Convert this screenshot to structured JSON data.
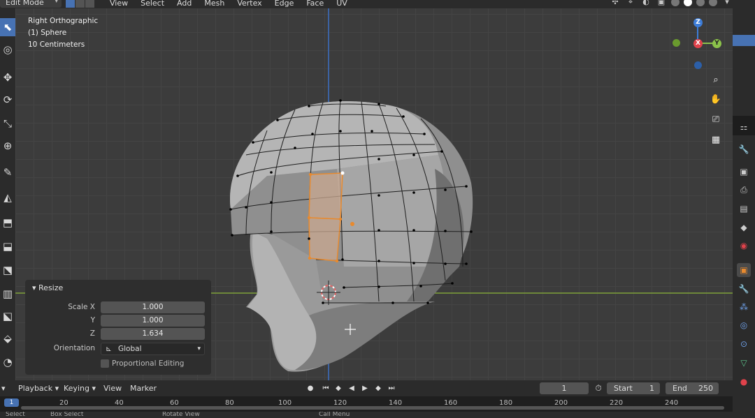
{
  "header": {
    "mode": "Edit Mode",
    "menus": [
      "View",
      "Select",
      "Add",
      "Mesh",
      "Vertex",
      "Edge",
      "Face",
      "UV"
    ]
  },
  "viewport": {
    "view_name": "Right Orthographic",
    "object_name": "(1) Sphere",
    "scale_text": "10 Centimeters",
    "gizmo": {
      "x": "X",
      "y": "Y",
      "z": "Z"
    }
  },
  "resize_panel": {
    "title": "Resize",
    "scale_x_label": "Scale X",
    "scale_x": "1.000",
    "y_label": "Y",
    "y": "1.000",
    "z_label": "Z",
    "z": "1.634",
    "orientation_label": "Orientation",
    "orientation": "Global",
    "proportional_label": "Proportional Editing"
  },
  "timeline": {
    "menus": [
      "Playback",
      "Keying",
      "View",
      "Marker"
    ],
    "current_frame": "1",
    "start_label": "Start",
    "start": "1",
    "end_label": "End",
    "end": "250",
    "ticks": [
      "20",
      "40",
      "60",
      "80",
      "100",
      "120",
      "140",
      "160",
      "180",
      "200",
      "220",
      "240"
    ],
    "playhead": "1"
  },
  "statusbar": {
    "items": [
      "Select",
      "Box Select",
      "Rotate View",
      "Call Menu"
    ]
  },
  "colors": {
    "accent": "#4772b3",
    "selection": "#e88a2e",
    "x_axis": "#e0424b",
    "y_axis": "#8bc34a",
    "z_axis": "#3d7dd8"
  }
}
